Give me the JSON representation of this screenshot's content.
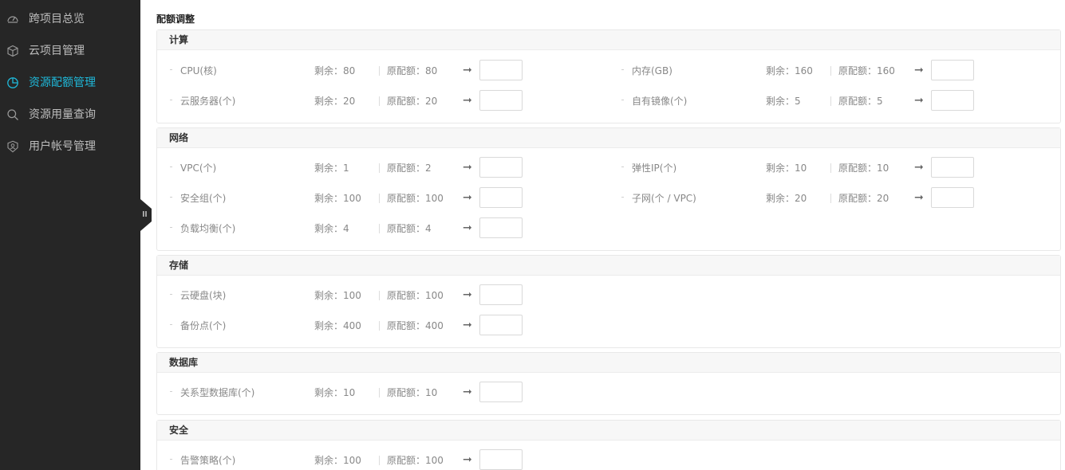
{
  "sidebar": {
    "items": [
      {
        "label": "跨项目总览",
        "icon": "dashboard-icon",
        "active": false
      },
      {
        "label": "云项目管理",
        "icon": "cube-icon",
        "active": false
      },
      {
        "label": "资源配额管理",
        "icon": "pie-chart-icon",
        "active": true
      },
      {
        "label": "资源用量查询",
        "icon": "search-icon",
        "active": false
      },
      {
        "label": "用户帐号管理",
        "icon": "user-shield-icon",
        "active": false
      }
    ],
    "active_color": "#1fb8d9",
    "background": "#262626"
  },
  "page_title": "配额调整",
  "sections": {
    "compute": {
      "title": "计算",
      "rows": [
        {
          "name": "CPU(核)",
          "remain": "剩余：80",
          "orig": "原配额：80",
          "arrow": "➞"
        },
        {
          "name": "内存(GB)",
          "remain": "剩余：160",
          "orig": "原配额：160",
          "arrow": "➞"
        },
        {
          "name": "云服务器(个)",
          "remain": "剩余：20",
          "orig": "原配额：20",
          "arrow": "➞"
        },
        {
          "name": "自有镜像(个)",
          "remain": "剩余：5",
          "orig": "原配额：5",
          "arrow": "➞"
        }
      ]
    },
    "network": {
      "title": "网络",
      "rows": [
        {
          "name": "VPC(个)",
          "remain": "剩余：1",
          "orig": "原配额：2",
          "arrow": "➞"
        },
        {
          "name": "弹性IP(个)",
          "remain": "剩余：10",
          "orig": "原配额：10",
          "arrow": "➞"
        },
        {
          "name": "安全组(个)",
          "remain": "剩余：100",
          "orig": "原配额：100",
          "arrow": "➞"
        },
        {
          "name": "子网(个 / VPC)",
          "remain": "剩余：20",
          "orig": "原配额：20",
          "arrow": "➞"
        },
        {
          "name": "负载均衡(个)",
          "remain": "剩余：4",
          "orig": "原配额：4",
          "arrow": "➞"
        }
      ]
    },
    "storage": {
      "title": "存储",
      "rows": [
        {
          "name": "云硬盘(块)",
          "remain": "剩余：100",
          "orig": "原配额：100",
          "arrow": "➞"
        },
        {
          "name": "备份点(个)",
          "remain": "剩余：400",
          "orig": "原配额：400",
          "arrow": "➞"
        }
      ]
    },
    "database": {
      "title": "数据库",
      "rows": [
        {
          "name": "关系型数据库(个)",
          "remain": "剩余：10",
          "orig": "原配额：10",
          "arrow": "➞"
        }
      ]
    },
    "security": {
      "title": "安全",
      "rows": [
        {
          "name": "告警策略(个)",
          "remain": "剩余：100",
          "orig": "原配额：100",
          "arrow": "➞"
        }
      ]
    }
  }
}
